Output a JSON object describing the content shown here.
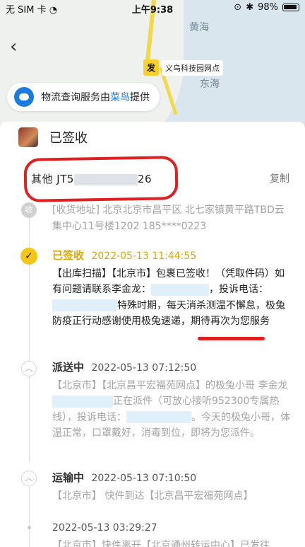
{
  "status_bar": {
    "carrier": "无 SIM 卡",
    "time": "上午9:38",
    "battery": "98%"
  },
  "map": {
    "sea_top": "黄海",
    "sea_bottom": "东海",
    "pin_badge": "发",
    "pin_label": "义乌科技园网点"
  },
  "provider": {
    "prefix": "物流查询服务由",
    "brand": "菜鸟",
    "suffix": "提供"
  },
  "package": {
    "title": "已签收",
    "tracking_prefix": "其他 JT5",
    "tracking_suffix": "26",
    "copy_label": "复制"
  },
  "address_node": {
    "icon_text": "收",
    "text": "[收货地址] 北京北京市昌平区 北七家镇黄平路TBD云集中心11号楼1202 185****0223"
  },
  "events": [
    {
      "status": "已签收",
      "time": "2022-05-13 11:44:55",
      "desc_1": "【出库扫描】【北京市】包裹已签收！（凭取件码）如有问题请联系李金龙：",
      "desc_2": "，投诉电话：",
      "desc_3": "特殊时期，每天消杀测温不懈怠，极兔防疫正行动感谢使用极兔速递，期待再次为您服务"
    },
    {
      "status": "派送中",
      "time": "2022-05-13 07:12:50",
      "desc_1": "【北京市】【北京昌平宏福苑网点】的极兔小哥 李金龙",
      "desc_2": "正在派件（可放心接听952300专属热线），投诉电话：",
      "desc_3": "。今天的极兔小哥，体温正常，口罩戴好，消毒到位，即将为您派件。"
    },
    {
      "status": "运输中",
      "time": "2022-05-13 07:10:50",
      "desc_1": "【北京市】 快件到达【北京昌平宏福苑网点】"
    },
    {
      "status": "",
      "time": "2022-05-13 03:29:27",
      "desc_1": "【北京市】快件离开【北京通州转运中心】已发往"
    }
  ]
}
